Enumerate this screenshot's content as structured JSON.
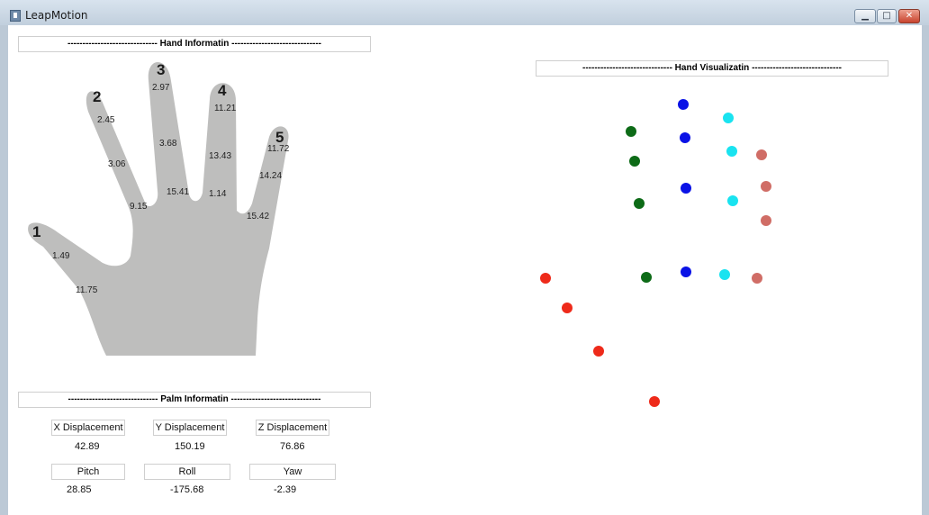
{
  "window": {
    "title": "LeapMotion",
    "icons": {
      "app": "app-icon",
      "minimize": "minimize-icon",
      "maximize": "maximize-icon",
      "close": "close-icon"
    }
  },
  "hand_info": {
    "header": "------------------------------ Hand   Informatin ------------------------------",
    "fingers": [
      {
        "number": "1",
        "values": [
          "1.49",
          "11.75"
        ]
      },
      {
        "number": "2",
        "values": [
          "2.45",
          "3.06",
          "9.15"
        ]
      },
      {
        "number": "3",
        "values": [
          "2.97",
          "3.68",
          "15.41"
        ]
      },
      {
        "number": "4",
        "values": [
          "11.21",
          "13.43",
          "1.14"
        ]
      },
      {
        "number": "5",
        "values": [
          "11.72",
          "14.24",
          "15.42"
        ]
      }
    ]
  },
  "palm_info": {
    "header": "------------------------------ Palm   Informatin ------------------------------",
    "x_label": "X Displacement",
    "x_value": "42.89",
    "y_label": "Y Displacement",
    "y_value": "150.19",
    "z_label": "Z Displacement",
    "z_value": "76.86",
    "pitch_label": "Pitch",
    "pitch_value": "28.85",
    "roll_label": "Roll",
    "roll_value": "-175.68",
    "yaw_label": "Yaw",
    "yaw_value": "-2.39"
  },
  "visualization": {
    "header": "------------------------------ Hand   Visualizatin ------------------------------",
    "finger_colors": {
      "thumb": "#ee2a1a",
      "index": "#0d6b17",
      "middle": "#0a12e6",
      "ring": "#19e3f0",
      "pinky": "#d06d66"
    }
  }
}
